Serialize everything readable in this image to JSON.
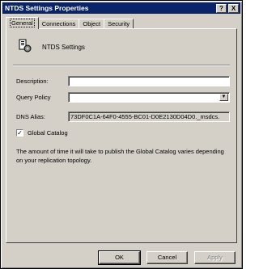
{
  "window": {
    "title": "NTDS Settings Properties",
    "help_glyph": "?",
    "close_glyph": "X"
  },
  "tabs": [
    {
      "label": "General",
      "active": true
    },
    {
      "label": "Connections",
      "active": false
    },
    {
      "label": "Object",
      "active": false
    },
    {
      "label": "Security",
      "active": false
    }
  ],
  "general": {
    "object_name": "NTDS Settings",
    "object_icon": "ntds-settings-icon",
    "description_label": "Description:",
    "description_value": "",
    "query_policy_label": "Query Policy",
    "query_policy_value": "",
    "dns_alias_label": "DNS Alias:",
    "dns_alias_value": "73DF0C1A-64F0-4555-BC01-D0E2130D04D0._msdcs.",
    "global_catalog_label": "Global Catalog",
    "global_catalog_checked": true,
    "check_glyph": "✓",
    "dropdown_glyph": "▼",
    "gc_description": "The amount of time it will take to publish the Global Catalog varies depending on your replication topology."
  },
  "buttons": {
    "ok": "OK",
    "cancel": "Cancel",
    "apply": "Apply"
  }
}
